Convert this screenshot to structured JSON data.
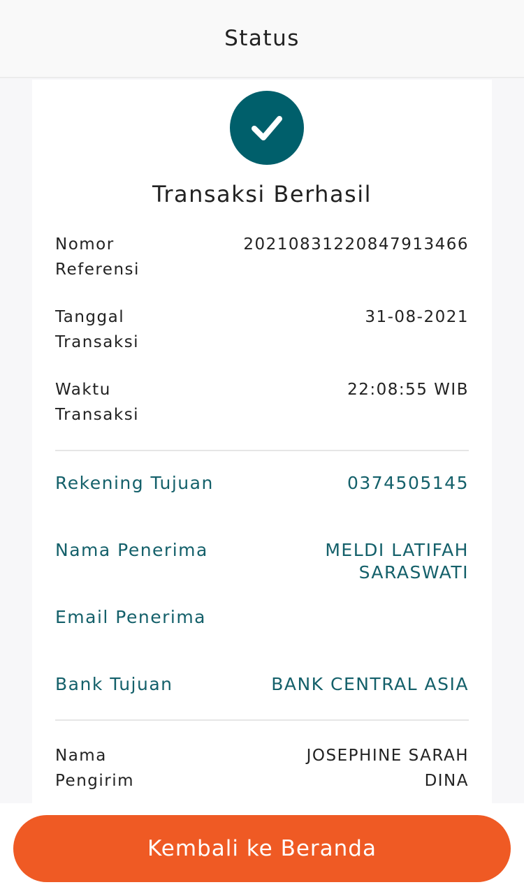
{
  "header": {
    "title": "Status"
  },
  "status": {
    "icon": "check-icon",
    "title": "Transaksi Berhasil",
    "accent_color": "#005f6b"
  },
  "transaction": {
    "reference_label": "Nomor Referensi",
    "reference_value": "20210831220847913466",
    "date_label": "Tanggal Transaksi",
    "date_value": "31-08-2021",
    "time_label": "Waktu Transaksi",
    "time_value": "22:08:55 WIB"
  },
  "recipient": {
    "account_label": "Rekening Tujuan",
    "account_value": "0374505145",
    "name_label": "Nama Penerima",
    "name_value": "MELDI LATIFAH SARASWATI",
    "email_label": "Email Penerima",
    "email_value": "",
    "bank_label": "Bank Tujuan",
    "bank_value": "BANK CENTRAL ASIA",
    "text_color": "#14606a"
  },
  "sender": {
    "name_label": "Nama Pengirim",
    "name_value": "JOSEPHINE SARAH DINA"
  },
  "footer": {
    "home_button_label": "Kembali ke Beranda",
    "button_color": "#ef5a24"
  }
}
